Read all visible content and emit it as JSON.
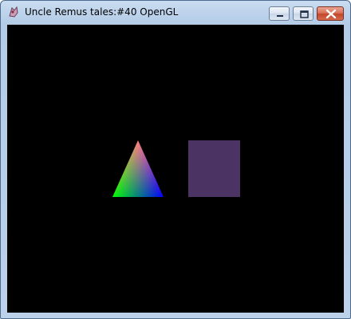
{
  "window": {
    "title": "Uncle Remus tales:#40 OpenGL",
    "title_icon": "app-logo-icon",
    "controls": {
      "minimize_icon": "minimize-icon",
      "maximize_icon": "maximize-icon",
      "close_icon": "close-icon"
    }
  },
  "canvas": {
    "background": "#000000",
    "triangle": {
      "vertex_colors": {
        "top": "#ff0000",
        "bottom_left": "#00ff00",
        "bottom_right": "#0000ff"
      }
    },
    "square": {
      "fill": "#4b3464"
    }
  }
}
